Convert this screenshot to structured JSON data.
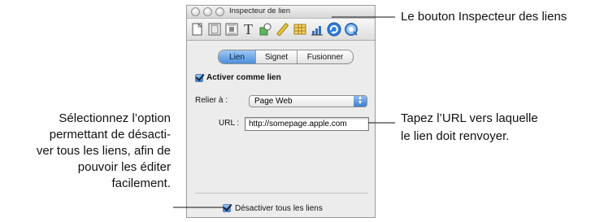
{
  "window": {
    "title": "Inspecteur de lien"
  },
  "toolbar": {
    "icons": [
      "document-icon",
      "layout-icon",
      "wrap-icon",
      "text-icon",
      "graphic-icon",
      "metrics-icon",
      "table-icon",
      "chart-icon",
      "link-icon",
      "quicktime-icon"
    ]
  },
  "tabs": [
    {
      "label": "Lien",
      "selected": true
    },
    {
      "label": "Signet",
      "selected": false
    },
    {
      "label": "Fusionner",
      "selected": false
    }
  ],
  "link": {
    "enable_label": "Activer comme lien",
    "enable_checked": true,
    "link_to_label": "Relier à :",
    "link_to_value": "Page Web",
    "url_label": "URL :",
    "url_value": "http://somepage.apple.com"
  },
  "footer": {
    "disable_all_label": "Désactiver tous les liens",
    "disable_all_checked": true
  },
  "callouts": {
    "link_inspector_button": "Le bouton Inspecteur des liens",
    "url_line1": "Tapez l’URL vers laquelle",
    "url_line2": "le lien doit renvoyer.",
    "disable_line1": "Sélectionnez l’option",
    "disable_line2": "permettant de désacti-",
    "disable_line3": "ver tous les liens, afin de",
    "disable_line4": "pouvoir les éditer",
    "disable_line5": "facilement."
  },
  "colors": {
    "accent": "#3f7fd0",
    "panel_bg": "#ececec"
  }
}
